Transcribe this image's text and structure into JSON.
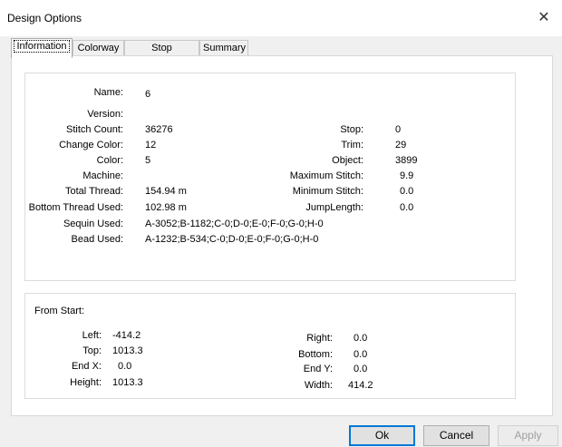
{
  "window": {
    "title": "Design Options",
    "close_glyph": "✕"
  },
  "tabs": [
    {
      "label": "Information",
      "active": true
    },
    {
      "label": "Colorway"
    },
    {
      "label": "Stop Sequence"
    },
    {
      "label": "Summary"
    }
  ],
  "info": {
    "name_label": "Name:",
    "name_value": "6",
    "version_label": "Version:",
    "version_value": "",
    "stitch_count_label": "Stitch Count:",
    "stitch_count_value": "36276",
    "change_color_label": "Change Color:",
    "change_color_value": "12",
    "color_label": "Color:",
    "color_value": "5",
    "machine_label": "Machine:",
    "machine_value": "",
    "total_thread_label": "Total Thread:",
    "total_thread_value": "154.94 m",
    "bottom_thread_label": "Bottom Thread Used:",
    "bottom_thread_value": "102.98 m",
    "sequin_label": "Sequin Used:",
    "sequin_value": "A-3052;B-1182;C-0;D-0;E-0;F-0;G-0;H-0",
    "bead_label": "Bead Used:",
    "bead_value": "A-1232;B-534;C-0;D-0;E-0;F-0;G-0;H-0",
    "stop_label": "Stop:",
    "stop_value": "0",
    "trim_label": "Trim:",
    "trim_value": "29",
    "object_label": "Object:",
    "object_value": "3899",
    "max_stitch_label": "Maximum Stitch:",
    "max_stitch_value": "9.9",
    "min_stitch_label": "Minimum Stitch:",
    "min_stitch_value": "0.0",
    "jump_length_label": "JumpLength:",
    "jump_length_value": "0.0"
  },
  "from_start": {
    "title": "From Start:",
    "left_label": "Left:",
    "left_value": "-414.2",
    "top_label": "Top:",
    "top_value": "1013.3",
    "endx_label": "End X:",
    "endx_value": "0.0",
    "height_label": "Height:",
    "height_value": "1013.3",
    "right_label": "Right:",
    "right_value": "0.0",
    "bottom_label": "Bottom:",
    "bottom_value": "0.0",
    "endy_label": "End Y:",
    "endy_value": "0.0",
    "width_label": "Width:",
    "width_value": "414.2"
  },
  "buttons": {
    "ok": "Ok",
    "cancel": "Cancel",
    "apply": "Apply"
  },
  "colors": {
    "accent": "#0078d7",
    "panel_bg": "#ffffff",
    "dialog_bg": "#f0f0f0"
  }
}
